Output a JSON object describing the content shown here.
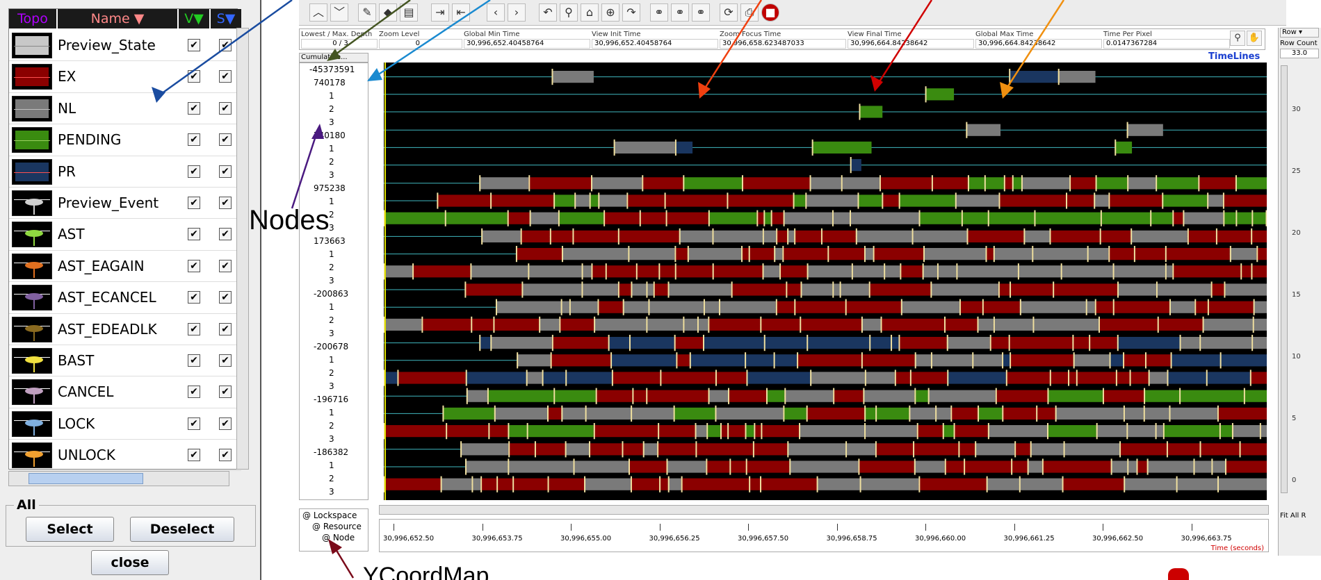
{
  "legend": {
    "headers": {
      "topo": "Topo",
      "name": "Name",
      "v": "V",
      "s": "S"
    },
    "items": [
      {
        "name": "Preview_State",
        "swatch": "rect",
        "fill": "#c8c8c8",
        "line": "#888888",
        "v": true,
        "s": true
      },
      {
        "name": "EX",
        "swatch": "rect",
        "fill": "#8b0000",
        "line": "#ff5050",
        "v": true,
        "s": true
      },
      {
        "name": "NL",
        "swatch": "rect",
        "fill": "#7a7a7a",
        "line": "#c0c0c0",
        "v": true,
        "s": true
      },
      {
        "name": "PENDING",
        "swatch": "rect",
        "fill": "#3a8b10",
        "line": "#9ad060",
        "v": true,
        "s": true
      },
      {
        "name": "PR",
        "swatch": "rect",
        "fill": "#1a3660",
        "line": "#ff5050",
        "v": true,
        "s": true
      },
      {
        "name": "Preview_Event",
        "swatch": "event",
        "fill": "#d0d0d0",
        "v": true,
        "s": true
      },
      {
        "name": "AST",
        "swatch": "event",
        "fill": "#8fd840",
        "v": true,
        "s": true
      },
      {
        "name": "AST_EAGAIN",
        "swatch": "event",
        "fill": "#e07020",
        "v": true,
        "s": true
      },
      {
        "name": "AST_ECANCEL",
        "swatch": "event",
        "fill": "#8060a0",
        "v": true,
        "s": true
      },
      {
        "name": "AST_EDEADLK",
        "swatch": "event",
        "fill": "#8a6a20",
        "v": true,
        "s": true
      },
      {
        "name": "BAST",
        "swatch": "event",
        "fill": "#f0e040",
        "v": true,
        "s": true
      },
      {
        "name": "CANCEL",
        "swatch": "event",
        "fill": "#c0a0c0",
        "v": true,
        "s": true
      },
      {
        "name": "LOCK",
        "swatch": "event",
        "fill": "#80b0e0",
        "v": true,
        "s": true
      },
      {
        "name": "UNLOCK",
        "swatch": "event",
        "fill": "#f0a030",
        "v": true,
        "s": true
      }
    ],
    "all_group": "All",
    "select_label": "Select",
    "deselect_label": "Deselect",
    "close_label": "close"
  },
  "infobar": {
    "fields": [
      {
        "label": "Lowest / Max. Depth",
        "value": "0 / 3"
      },
      {
        "label": "Zoom Level",
        "value": "0"
      },
      {
        "label": "Global Min Time",
        "value": "30,996,652.40458764"
      },
      {
        "label": "View Init Time",
        "value": "30,996,652.40458764"
      },
      {
        "label": "Zoom Focus Time",
        "value": "30,996,658.623487033"
      },
      {
        "label": "View Final Time",
        "value": "30,996,664.84238642"
      },
      {
        "label": "Global Max Time",
        "value": "30,996,664.84238642"
      },
      {
        "label": "Time Per Pixel",
        "value": "0.0147367284"
      }
    ],
    "mode_select": "Cumulative..."
  },
  "tree": {
    "root": "-45373591",
    "groups": [
      {
        "id": "740178",
        "children": [
          "1",
          "2",
          "3"
        ]
      },
      {
        "id": "740180",
        "children": [
          "1",
          "2",
          "3"
        ]
      },
      {
        "id": "975238",
        "children": [
          "1",
          "2",
          "3"
        ]
      },
      {
        "id": "173663",
        "children": [
          "1",
          "2",
          "3"
        ]
      },
      {
        "id": "-200863",
        "children": [
          "1",
          "2",
          "3"
        ]
      },
      {
        "id": "-200678",
        "children": [
          "1",
          "2",
          "3"
        ]
      },
      {
        "id": "-196716",
        "children": [
          "1",
          "2",
          "3"
        ]
      },
      {
        "id": "-186382",
        "children": [
          "1",
          "2",
          "3"
        ]
      }
    ]
  },
  "coordmap": [
    "@ Lockspace",
    "@ Resource",
    "@ Node"
  ],
  "canvas": {
    "title": "TimeLines"
  },
  "timeaxis": {
    "ticks": [
      "30,996,652.50",
      "30,996,653.75",
      "30,996,655.00",
      "30,996,656.25",
      "30,996,657.50",
      "30,996,658.75",
      "30,996,660.00",
      "30,996,661.25",
      "30,996,662.50",
      "30,996,663.75"
    ],
    "unit": "Time (seconds)"
  },
  "rightpanel": {
    "row_label": "Row",
    "row_count_label": "Row Count",
    "row_count_value": "33.0",
    "scale": [
      "30",
      "25",
      "20",
      "15",
      "10",
      "5",
      "0"
    ],
    "fit_label": "Fit All R"
  },
  "annotations": {
    "nodes": "Nodes",
    "ycoordmap": "YCoordMap"
  },
  "colors": {
    "ex": "#8b0000",
    "nl": "#7a7a7a",
    "pending": "#3a8b10",
    "pr": "#1a3660",
    "event_line": "#40b8c0",
    "event_tick": "#f0e0a0"
  }
}
